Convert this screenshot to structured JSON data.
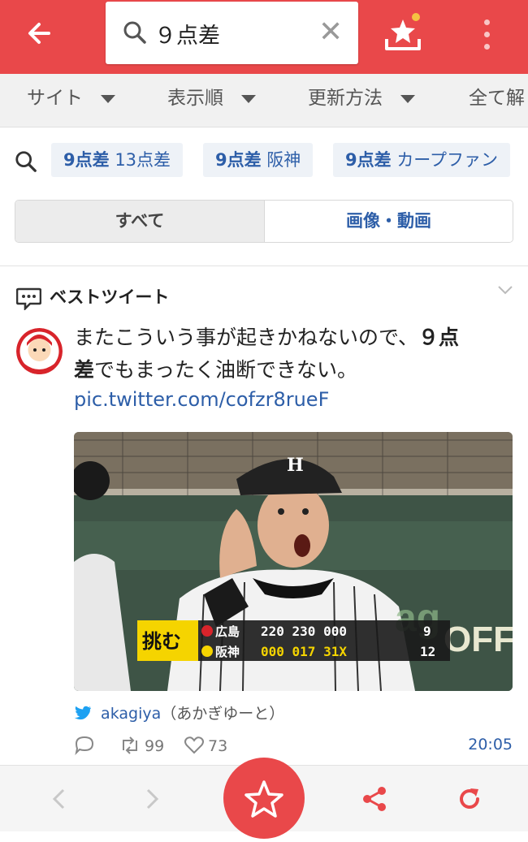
{
  "header": {
    "search_query": "９点差",
    "clear_label": "✕"
  },
  "filters": [
    {
      "label": "サイト"
    },
    {
      "label": "表示順"
    },
    {
      "label": "更新方法"
    },
    {
      "label": "全て解"
    }
  ],
  "related": [
    {
      "bold": "9点差",
      "rest": "13点差"
    },
    {
      "bold": "9点差",
      "rest": "阪神"
    },
    {
      "bold": "9点差",
      "rest": "カープファン"
    }
  ],
  "segment": {
    "all_label": "すべて",
    "media_label": "画像・動画"
  },
  "best": {
    "title": "ベストツイート"
  },
  "tweet": {
    "text_part1": "またこういう事が起きかねないので、",
    "text_bold1": "９点",
    "text_bold2": "差",
    "text_part2": "でもまったく油断できない。",
    "link": "pic.twitter.com/cofzr8rueF",
    "handle": "akagiya",
    "display_name": "（あかぎゆーと）",
    "retweets": "99",
    "likes": "73",
    "time": "20:05"
  },
  "scoreboard": {
    "badge": "挑む",
    "team1": "広島",
    "team1_innings": "220 230 000",
    "team1_total": "9",
    "team2": "阪神",
    "team2_innings": "000 017 31X",
    "team2_total": "12"
  },
  "colors": {
    "brand_red": "#e9484a",
    "link_blue": "#2d5ea8"
  },
  "icons": {
    "back": "arrow-left-icon",
    "search": "search-icon",
    "favorite": "star-tray-icon",
    "menu": "kebab-icon",
    "share": "share-icon",
    "reload": "reload-icon"
  }
}
